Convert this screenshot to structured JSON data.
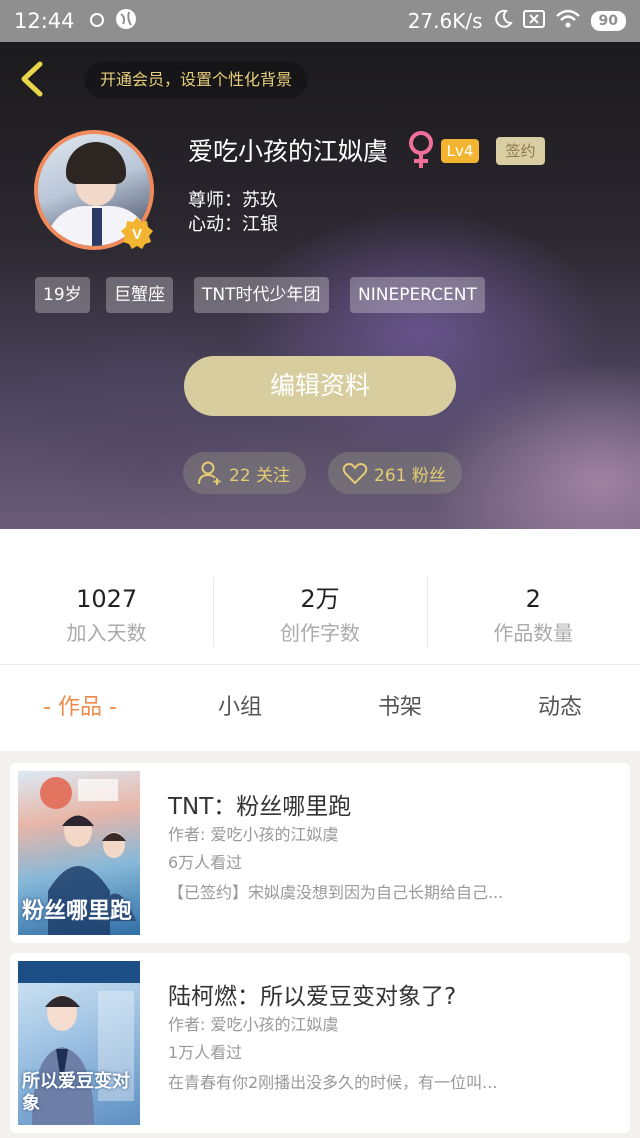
{
  "status_bar": {
    "time": "12:44",
    "speed": "27.6K/s",
    "battery": "90"
  },
  "header": {
    "vip_banner": "开通会员，设置个性化背景",
    "nickname": "爱吃小孩的江姒虞",
    "gender_symbol": "♀",
    "level": "Lv4",
    "sign_badge": "签约",
    "mentor": "尊师：苏玖",
    "crush": "心动：江银",
    "tags": [
      "19岁",
      "巨蟹座",
      "TNT时代少年团",
      "NINEPERCENT"
    ],
    "edit_button": "编辑资料",
    "follow": "22 关注",
    "fans": "261 粉丝",
    "accent": "#e5cc73"
  },
  "stats": [
    {
      "value": "1027",
      "label": "加入天数"
    },
    {
      "value": "2万",
      "label": "创作字数"
    },
    {
      "value": "2",
      "label": "作品数量"
    }
  ],
  "tabs": [
    "- 作品 -",
    "小组",
    "书架",
    "动态"
  ],
  "works": [
    {
      "title": "TNT：粉丝哪里跑",
      "author": "作者: 爱吃小孩的江姒虞",
      "views": "6万人看过",
      "desc": "【已签约】宋姒虞没想到因为自己长期给自己...",
      "cover_title": "粉丝哪里跑"
    },
    {
      "title": "陆柯燃：所以爱豆变对象了?",
      "author": "作者: 爱吃小孩的江姒虞",
      "views": "1万人看过",
      "desc": "在青春有你2刚播出没多久的时候，有一位叫...",
      "cover_title": "所以爱豆变对象"
    }
  ]
}
